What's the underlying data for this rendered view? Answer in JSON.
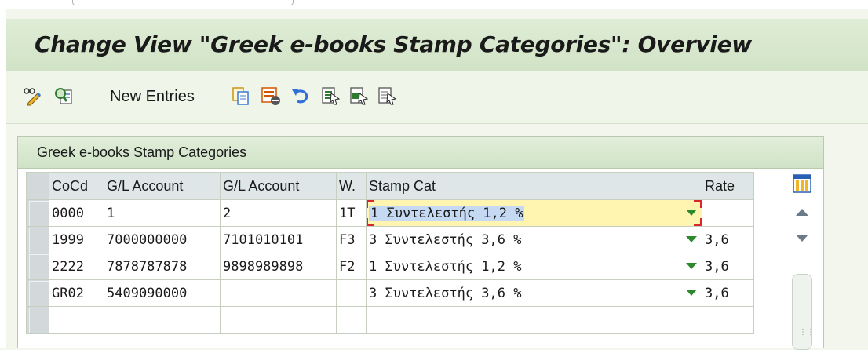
{
  "title": "Change View \"Greek e-books Stamp Categories\": Overview",
  "toolbar": {
    "new_entries_label": "New Entries",
    "icons": [
      "display-change-icon",
      "details-icon",
      "copy-icon",
      "delete-icon",
      "undo-icon",
      "select-all-icon",
      "select-block-icon",
      "deselect-all-icon"
    ]
  },
  "table": {
    "caption": "Greek e-books Stamp Categories",
    "columns": {
      "cocd": "CoCd",
      "gl1": "G/L Account",
      "gl2": "G/L Account",
      "w": "W.",
      "stamp": "Stamp Cat",
      "rate": "Rate"
    },
    "rows": [
      {
        "cocd": "0000",
        "gl1": "1",
        "gl2": "2",
        "w": "1T",
        "stamp": "1 Συντελεστής 1,2 %",
        "rate": ""
      },
      {
        "cocd": "1999",
        "gl1": "7000000000",
        "gl2": "7101010101",
        "w": "F3",
        "stamp": "3 Συντελεστής 3,6 %",
        "rate": "3,6"
      },
      {
        "cocd": "2222",
        "gl1": "7878787878",
        "gl2": "9898989898",
        "w": "F2",
        "stamp": "1 Συντελεστής 1,2 %",
        "rate": "3,6"
      },
      {
        "cocd": "GR02",
        "gl1": "5409090000",
        "gl2": "",
        "w": "",
        "stamp": "3 Συντελεστής 3,6 %",
        "rate": "3,6"
      }
    ]
  },
  "colors": {
    "title_bar": "#d7e7cd",
    "focused_cell": "#fff5b0",
    "dropdown_arrow": "#2c8a2c",
    "focus_corner": "#d8262a"
  }
}
